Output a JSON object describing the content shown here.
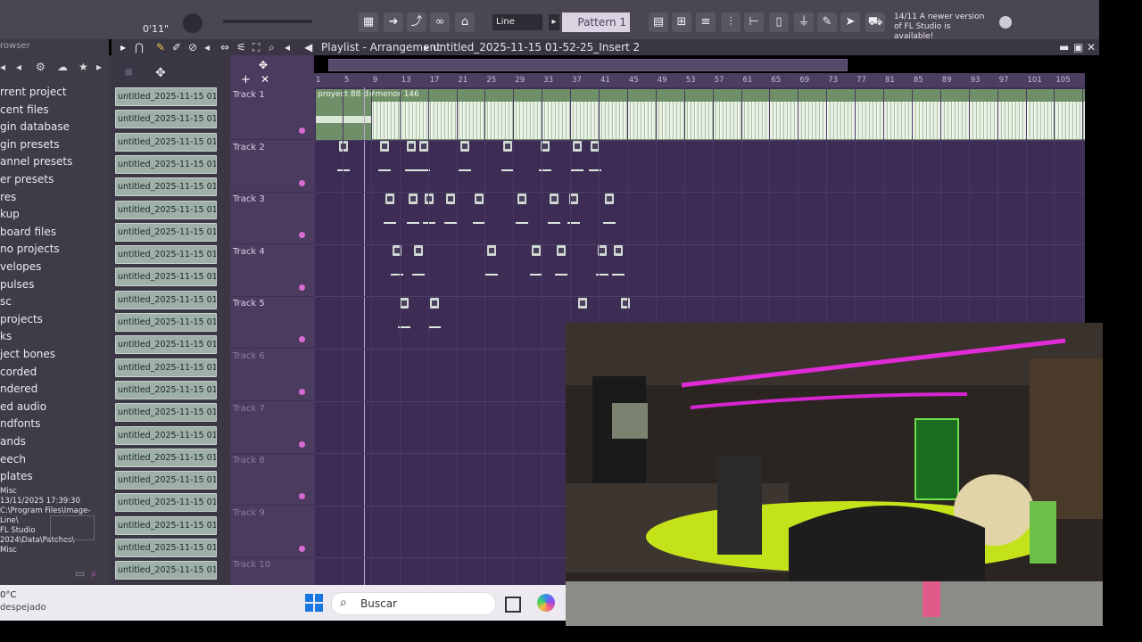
{
  "toolbar": {
    "time": "0'11\"",
    "snap_mode": "Line",
    "pattern": "Pattern 1",
    "notification": "14/11  A newer version of FL Studio is available!"
  },
  "playlist": {
    "title": "Playlist - Arrangement",
    "breadcrumb": "untitled_2025-11-15 01-52-25_Insert 2"
  },
  "browser": {
    "header": "rowser",
    "items": [
      "rrent project",
      "cent files",
      "gin database",
      "gin presets",
      "annel presets",
      "er presets",
      "res",
      "kup",
      "board files",
      "no projects",
      "velopes",
      "pulses",
      "sc",
      "projects",
      "ks",
      "ject bones",
      "corded",
      "ndered",
      "ed audio",
      "ndfonts",
      "ands",
      "eech",
      "plates"
    ],
    "info": [
      "Misc",
      "13/11/2025 17:39:30",
      "C:\\Program Files\\Image-Line\\",
      "FL Studio 2024\\Data\\Patches\\",
      "Misc"
    ]
  },
  "patterns": {
    "label": "untitled_2025-11-15 01-...",
    "count": 22
  },
  "tracks": [
    "Track 1",
    "Track 2",
    "Track 3",
    "Track 4",
    "Track 5",
    "Track 6",
    "Track 7",
    "Track 8",
    "Track 9",
    "Track 10"
  ],
  "ruler": [
    "1",
    "5",
    "9",
    "13",
    "17",
    "21",
    "25",
    "29",
    "33",
    "37",
    "41",
    "45",
    "49",
    "53",
    "57",
    "61",
    "65",
    "69",
    "73",
    "77",
    "81",
    "85",
    "89",
    "93",
    "97",
    "101",
    "105"
  ],
  "audio_clip": {
    "name": "proyect 88 d#menor 146"
  },
  "taskbar": {
    "weather_temp": "0°C",
    "weather_desc": "despejado",
    "search_placeholder": "Buscar"
  }
}
